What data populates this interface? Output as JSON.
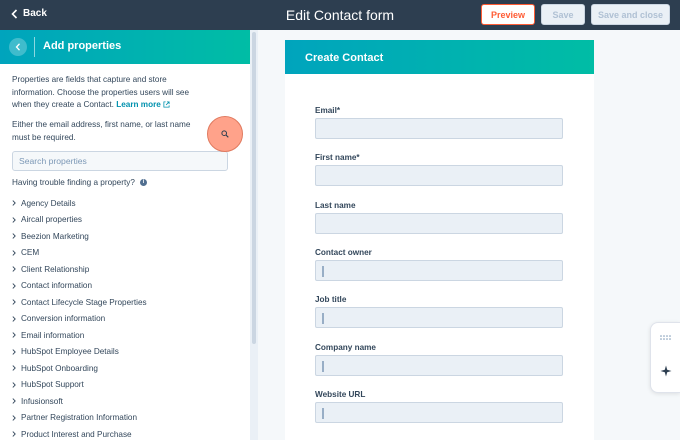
{
  "topbar": {
    "back_label": "Back",
    "title": "Edit Contact form",
    "preview_label": "Preview",
    "save_label": "Save",
    "save_close_label": "Save and close"
  },
  "panel": {
    "title": "Add properties",
    "intro_text": "Properties are fields that capture and store information. Choose the properties users will see when they create a Contact.",
    "learn_more": "Learn more",
    "requirement_text": "Either the email address, first name, or last name must be required.",
    "search_placeholder": "Search properties",
    "trouble_text": "Having trouble finding a property?",
    "groups": [
      "Agency Details",
      "Aircall properties",
      "Beezion Marketing",
      "CEM",
      "Client Relationship",
      "Contact information",
      "Contact Lifecycle Stage Properties",
      "Conversion information",
      "Email information",
      "HubSpot Employee Details",
      "HubSpot Onboarding",
      "HubSpot Support",
      "Infusionsoft",
      "Partner Registration Information",
      "Product Interest and Purchase"
    ]
  },
  "form": {
    "title": "Create Contact",
    "fields": [
      {
        "label": "Email*"
      },
      {
        "label": "First name*"
      },
      {
        "label": "Last name"
      },
      {
        "label": "Contact owner"
      },
      {
        "label": "Job title"
      },
      {
        "label": "Company name"
      },
      {
        "label": "Website URL"
      }
    ]
  },
  "colors": {
    "topbar": "#2d3e50",
    "accent_orange": "#ff5c35",
    "header_teal": "#00a4bd",
    "link": "#0091ae"
  },
  "icons": [
    "chevron-left-icon",
    "external-link-icon",
    "search-icon",
    "info-icon",
    "chevron-right-icon",
    "drag-handle-icon",
    "sparkle-icon",
    "grid-dots-icon"
  ]
}
